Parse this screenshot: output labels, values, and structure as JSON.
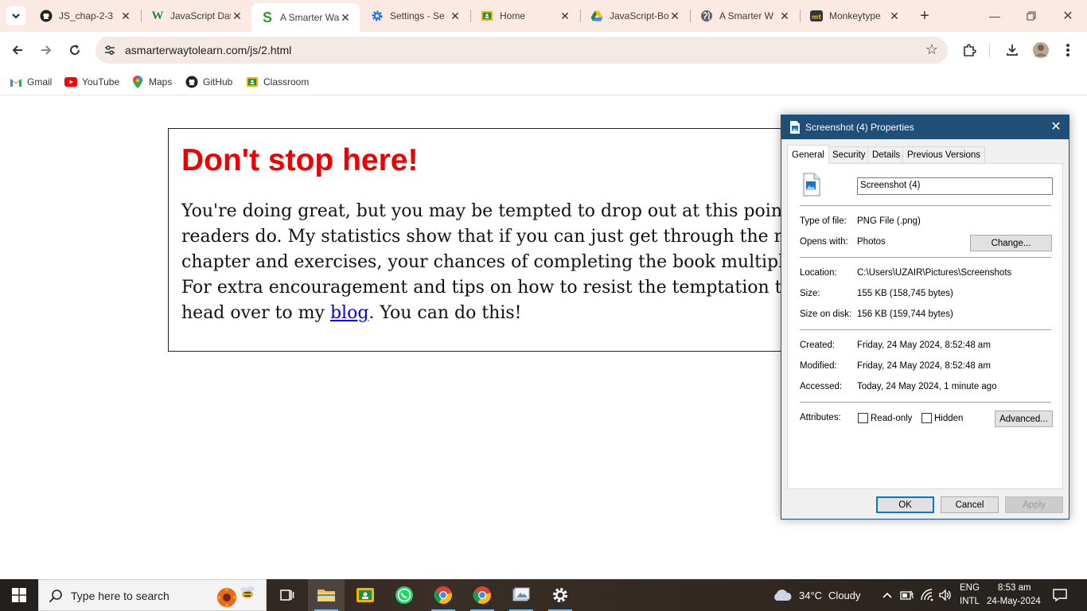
{
  "browser": {
    "tabs": [
      {
        "title": "JS_chap-2-3",
        "icon": "github-icon"
      },
      {
        "title": "JavaScript Data",
        "icon": "w-icon"
      },
      {
        "title": "A Smarter Way",
        "icon": "s-icon",
        "active": true
      },
      {
        "title": "Settings - Se",
        "icon": "gear-icon"
      },
      {
        "title": "Home",
        "icon": "classroom-icon"
      },
      {
        "title": "JavaScript-Bo",
        "icon": "drive-icon"
      },
      {
        "title": "A Smarter W",
        "icon": "globe-icon"
      },
      {
        "title": "Monkeytype",
        "icon": "monkeytype-icon"
      }
    ],
    "url": "asmarterwaytolearn.com/js/2.html",
    "bookmarks": [
      {
        "label": "Gmail",
        "icon": "gmail-icon"
      },
      {
        "label": "YouTube",
        "icon": "youtube-icon"
      },
      {
        "label": "Maps",
        "icon": "maps-icon"
      },
      {
        "label": "GitHub",
        "icon": "github-icon"
      },
      {
        "label": "Classroom",
        "icon": "classroom-icon"
      }
    ]
  },
  "page": {
    "heading": "Don't stop here!",
    "lines": [
      "You're doing great, but you may be tempted to drop out at this point. Many",
      "readers do. My statistics show that if you can just get through the next",
      "chapter and exercises, your chances of completing the book multiply by",
      "For extra encouragement and tips on how to resist the temptation to quit,"
    ],
    "last_line_before": "head over to my ",
    "link_text": "blog",
    "last_line_after": ". You can do this!"
  },
  "dialog": {
    "title": "Screenshot (4) Properties",
    "tabs": [
      "General",
      "Security",
      "Details",
      "Previous Versions"
    ],
    "filename": "Screenshot (4)",
    "type_label": "Type of file:",
    "type_value": "PNG File (.png)",
    "opens_label": "Opens with:",
    "opens_value": "Photos",
    "change_button": "Change...",
    "location_label": "Location:",
    "location_value": "C:\\Users\\UZAIR\\Pictures\\Screenshots",
    "size_label": "Size:",
    "size_value": "155 KB (158,745 bytes)",
    "disk_label": "Size on disk:",
    "disk_value": "156 KB (159,744 bytes)",
    "created_label": "Created:",
    "created_value": "Friday, 24 May 2024, 8:52:48 am",
    "modified_label": "Modified:",
    "modified_value": "Friday, 24 May 2024, 8:52:48 am",
    "accessed_label": "Accessed:",
    "accessed_value": "Today, 24 May 2024, 1 minute ago",
    "attributes_label": "Attributes:",
    "readonly_label": "Read-only",
    "hidden_label": "Hidden",
    "advanced_button": "Advanced...",
    "ok_button": "OK",
    "cancel_button": "Cancel",
    "apply_button": "Apply"
  },
  "taskbar": {
    "search_placeholder": "Type here to search",
    "weather_temp": "34°C",
    "weather_text": "Cloudy",
    "lang_top": "ENG",
    "lang_bottom": "INTL",
    "time": "8:53 am",
    "date": "24-May-2024"
  },
  "colors": {
    "heading_red": "#ee0000",
    "link_blue": "#0000ee",
    "dialog_title_bar": "#1f4e79",
    "tabstrip": "#fbe9e3"
  }
}
